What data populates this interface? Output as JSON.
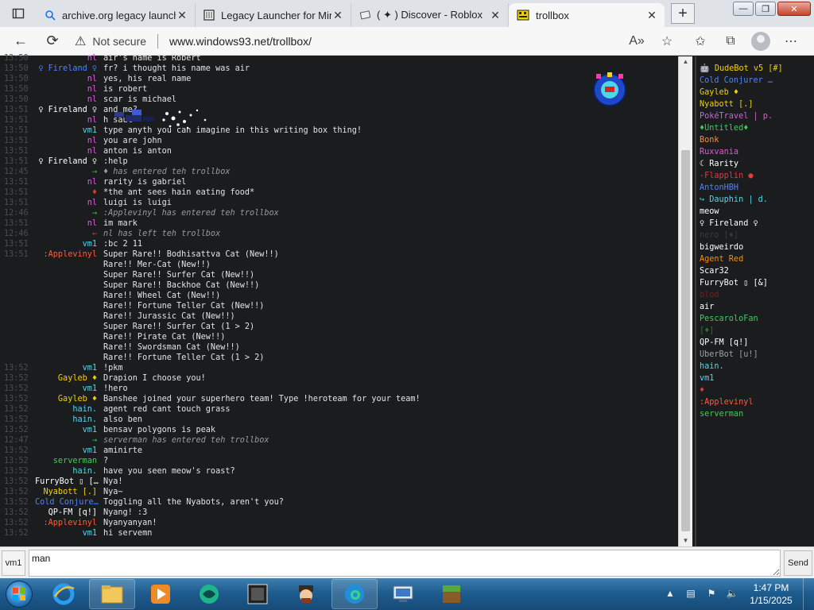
{
  "browser": {
    "tabs": [
      {
        "title": "archive.org legacy launch",
        "icon": "search-icon",
        "active": false
      },
      {
        "title": "Legacy Launcher for Mine",
        "icon": "page-icon",
        "active": false
      },
      {
        "title": "( ✦ ) Discover - Roblox",
        "icon": "roblox-icon",
        "active": false
      },
      {
        "title": "trollbox",
        "icon": "trollbox-icon",
        "active": true
      }
    ],
    "new_tab_label": "+",
    "not_secure": "Not secure",
    "url": "www.windows93.net/trollbox/",
    "back_icon": "←",
    "reload_icon": "⟳",
    "read_aloud_icon": "A»",
    "more_label": "⋯"
  },
  "messages": [
    {
      "time": "13:50",
      "nick": "nl",
      "color": "#d85fd8",
      "text": "air's name is Robert"
    },
    {
      "time": "13:50",
      "nick": "♀ Fireland ♀",
      "color": "#4b84ff",
      "text": "fr? i thought his name was air"
    },
    {
      "time": "13:50",
      "nick": "nl",
      "color": "#d85fd8",
      "text": "yes, his real name"
    },
    {
      "time": "13:50",
      "nick": "nl",
      "color": "#d85fd8",
      "text": "is robert"
    },
    {
      "time": "13:50",
      "nick": "nl",
      "color": "#d85fd8",
      "text": "scar is michael"
    },
    {
      "time": "13:51",
      "nick": "♀ Fireland ♀",
      "color": "#ffffff",
      "text": "and me?"
    },
    {
      "time": "13:51",
      "nick": "nl",
      "color": "#d85fd8",
      "text": "h        saul"
    },
    {
      "time": "13:51",
      "nick": "vm1",
      "color": "#55d6e8",
      "text": "type anyth      you can imagine in this writing box thing!"
    },
    {
      "time": "13:51",
      "nick": "nl",
      "color": "#d85fd8",
      "text": "you are john"
    },
    {
      "time": "13:51",
      "nick": "nl",
      "color": "#d85fd8",
      "text": "anton is anton"
    },
    {
      "time": "13:51",
      "nick": "♀ Fireland ♀",
      "color": "#ffffff",
      "text": ":help"
    },
    {
      "time": "12:45",
      "nick": "→",
      "color": "#44c95b",
      "text": "♦ has entered teh trollbox",
      "sys": true
    },
    {
      "time": "13:51",
      "nick": "nl",
      "color": "#d85fd8",
      "text": "rarity is gabriel"
    },
    {
      "time": "13:51",
      "nick": "♦",
      "color": "#e23b3b",
      "text": "*the ant sees hain eating food*"
    },
    {
      "time": "13:51",
      "nick": "nl",
      "color": "#d85fd8",
      "text": "luigi is luigi"
    },
    {
      "time": "12:46",
      "nick": "→",
      "color": "#44c95b",
      "text": ":Applevinyl has entered teh trollbox",
      "sys": true
    },
    {
      "time": "13:51",
      "nick": "nl",
      "color": "#d85fd8",
      "text": "im mark"
    },
    {
      "time": "12:46",
      "nick": "←",
      "color": "#e23b3b",
      "text": "nl has left teh trollbox",
      "sys": true
    },
    {
      "time": "13:51",
      "nick": "vm1",
      "color": "#55d6e8",
      "text": ":bc 2 11"
    },
    {
      "time": "13:51",
      "nick": ":Applevinyl",
      "color": "#ff5a3c",
      "text": "Super Rare!! Bodhisattva Cat (New!!)"
    },
    {
      "time": "",
      "nick": "",
      "color": "#ffffff",
      "text": "Rare!! Mer-Cat (New!!)"
    },
    {
      "time": "",
      "nick": "",
      "color": "#ffffff",
      "text": "Super Rare!! Surfer Cat (New!!)"
    },
    {
      "time": "",
      "nick": "",
      "color": "#ffffff",
      "text": "Super Rare!! Backhoe Cat (New!!)"
    },
    {
      "time": "",
      "nick": "",
      "color": "#ffffff",
      "text": "Rare!! Wheel Cat (New!!)"
    },
    {
      "time": "",
      "nick": "",
      "color": "#ffffff",
      "text": "Rare!! Fortune Teller Cat (New!!)"
    },
    {
      "time": "",
      "nick": "",
      "color": "#ffffff",
      "text": "Rare!! Jurassic Cat (New!!)"
    },
    {
      "time": "",
      "nick": "",
      "color": "#ffffff",
      "text": "Super Rare!! Surfer Cat (1 > 2)"
    },
    {
      "time": "",
      "nick": "",
      "color": "#ffffff",
      "text": "Rare!! Pirate Cat (New!!)"
    },
    {
      "time": "",
      "nick": "",
      "color": "#ffffff",
      "text": "Rare!! Swordsman Cat (New!!)"
    },
    {
      "time": "",
      "nick": "",
      "color": "#ffffff",
      "text": "Rare!! Fortune Teller Cat (1 > 2)"
    },
    {
      "time": "13:52",
      "nick": "vm1",
      "color": "#55d6e8",
      "text": "!pkm"
    },
    {
      "time": "13:52",
      "nick": "Gayleb ♦",
      "color": "#f2d100",
      "text": "Drapion I choose you!"
    },
    {
      "time": "13:52",
      "nick": "vm1",
      "color": "#55d6e8",
      "text": "!hero"
    },
    {
      "time": "13:52",
      "nick": "Gayleb ♦",
      "color": "#f2d100",
      "text": "Banshee joined your superhero team! Type !heroteam for your team!"
    },
    {
      "time": "13:52",
      "nick": "hain.",
      "color": "#55d6e8",
      "text": "agent red cant touch grass"
    },
    {
      "time": "13:52",
      "nick": "hain.",
      "color": "#55d6e8",
      "text": "also ben"
    },
    {
      "time": "13:52",
      "nick": "vm1",
      "color": "#55d6e8",
      "text": "bensav polygons is peak"
    },
    {
      "time": "12:47",
      "nick": "→",
      "color": "#44c95b",
      "text": "serverman has entered teh trollbox",
      "sys": true
    },
    {
      "time": "13:52",
      "nick": "vm1",
      "color": "#55d6e8",
      "text": "aminirte"
    },
    {
      "time": "13:52",
      "nick": "serverman",
      "color": "#44c95b",
      "text": "?"
    },
    {
      "time": "13:52",
      "nick": "hain.",
      "color": "#55d6e8",
      "text": "have you seen meow's roast?"
    },
    {
      "time": "13:52",
      "nick": "FurryBot ▯ […",
      "color": "#ffffff",
      "text": "Nya!"
    },
    {
      "time": "13:52",
      "nick": "Nyabott [.]",
      "color": "#f2d100",
      "text": "Nya~"
    },
    {
      "time": "13:52",
      "nick": "Cold Conjure…",
      "color": "#4b84ff",
      "text": "Toggling all the Nyabots, aren't you?"
    },
    {
      "time": "13:52",
      "nick": "QP-FM [q!]",
      "color": "#ffffff",
      "text": "Nyang! :3"
    },
    {
      "time": "13:52",
      "nick": ":Applevinyl",
      "color": "#ff5a3c",
      "text": "Nyanyanyan!"
    },
    {
      "time": "13:52",
      "nick": "vm1",
      "color": "#55d6e8",
      "text": "hi servemn"
    }
  ],
  "users": [
    {
      "name": "🤖 DudeBot v5 [#]",
      "color": "#f2d100"
    },
    {
      "name": "Cold Conjurer …",
      "color": "#4b84ff"
    },
    {
      "name": "Gayleb ♦",
      "color": "#f2d100"
    },
    {
      "name": "Nyabott [.]",
      "color": "#f2d100"
    },
    {
      "name": "PokéTravel | p.",
      "color": "#d85fd8"
    },
    {
      "name": "♦Untitled♦",
      "color": "#44c95b"
    },
    {
      "name": "Bonk",
      "color": "#ff8a3c"
    },
    {
      "name": "Ruxvania",
      "color": "#d85fd8"
    },
    {
      "name": "☾ Rarity",
      "color": "#ffffff"
    },
    {
      "name": "-Flapplin ●",
      "color": "#e23b3b"
    },
    {
      "name": "AntonHBH",
      "color": "#4b84ff"
    },
    {
      "name": "↪ Dauphin | d.",
      "color": "#55d6e8"
    },
    {
      "name": "meow",
      "color": "#ffffff"
    },
    {
      "name": "♀ Fireland ♀",
      "color": "#ffffff"
    },
    {
      "name": "nero [♦]",
      "color": "#3a3a3a"
    },
    {
      "name": "bigweirdo",
      "color": "#ffffff"
    },
    {
      "name": "Agent Red",
      "color": "#ff8a00"
    },
    {
      "name": "Scar32",
      "color": "#ffffff"
    },
    {
      "name": "FurryBot ▯ [&]",
      "color": "#ffffff"
    },
    {
      "name": "blod",
      "color": "#7a1f1f"
    },
    {
      "name": "air",
      "color": "#ffffff"
    },
    {
      "name": "PescaroloFan",
      "color": "#44c95b"
    },
    {
      "name": "[♦]",
      "color": "#2f6e2f"
    },
    {
      "name": "QP-FM [q!]",
      "color": "#ffffff"
    },
    {
      "name": "UberBot [u!]",
      "color": "#9aa0a6"
    },
    {
      "name": "hain.",
      "color": "#55d6e8"
    },
    {
      "name": "vm1",
      "color": "#55d6e8"
    },
    {
      "name": "♦",
      "color": "#e23b3b"
    },
    {
      "name": ":Applevinyl",
      "color": "#ff5a3c"
    },
    {
      "name": "serverman",
      "color": "#44c95b"
    }
  ],
  "input": {
    "nick_label": "vm1",
    "value": "man",
    "send_label": "Send"
  },
  "taskbar": {
    "time": "1:47 PM",
    "date": "1/15/2025",
    "pinned": [
      "internet-explorer-icon",
      "file-explorer-icon",
      "media-player-icon",
      "app-icon",
      "windows93-icon",
      "pirate-app-icon",
      "edge-icon",
      "network-icon",
      "minecraft-icon"
    ]
  }
}
